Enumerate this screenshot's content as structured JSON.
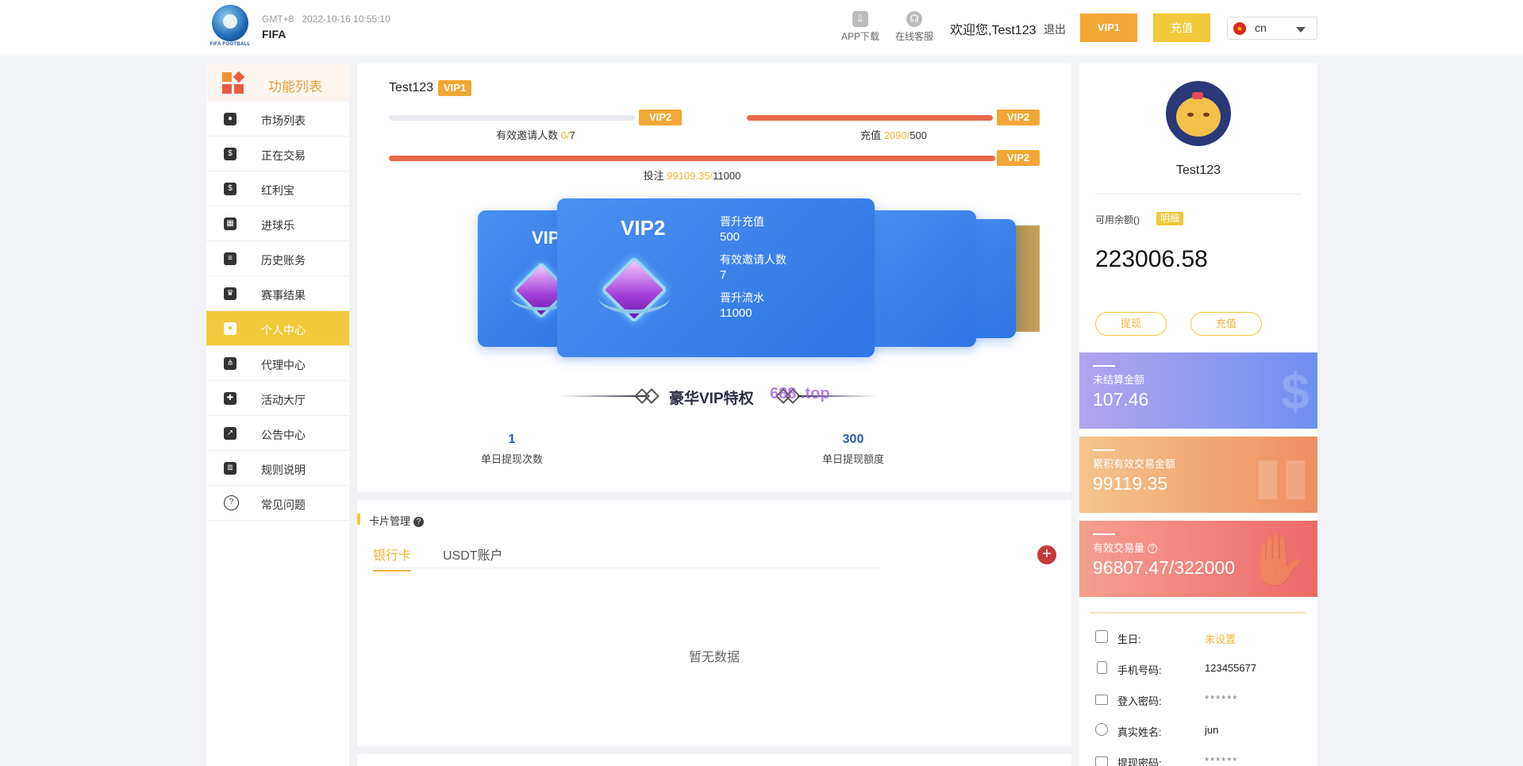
{
  "header": {
    "logo_text": "FIFA FOOTBALL",
    "timezone": "GMT+8",
    "datetime": "2022-10-16 10:55:10",
    "site_name": "FIFA",
    "app_download": "APP下载",
    "online_service": "在线客服",
    "welcome": "欢迎您,Test123",
    "logout": "退出",
    "vip_button": "VIP1",
    "recharge_button": "充值",
    "language": "cn"
  },
  "sidebar": {
    "title": "功能列表",
    "items": [
      {
        "label": "市场列表",
        "icon": "soccer-ball-icon"
      },
      {
        "label": "正在交易",
        "icon": "money-icon"
      },
      {
        "label": "红利宝",
        "icon": "coins-icon"
      },
      {
        "label": "进球乐",
        "icon": "goal-icon"
      },
      {
        "label": "历史账务",
        "icon": "history-icon"
      },
      {
        "label": "赛事结果",
        "icon": "trophy-icon"
      },
      {
        "label": "个人中心",
        "icon": "user-icon",
        "active": true
      },
      {
        "label": "代理中心",
        "icon": "network-icon"
      },
      {
        "label": "活动大厅",
        "icon": "gift-icon"
      },
      {
        "label": "公告中心",
        "icon": "chart-icon"
      },
      {
        "label": "规则说明",
        "icon": "document-icon"
      },
      {
        "label": "常见问题",
        "icon": "question-icon"
      }
    ]
  },
  "vip_progress": {
    "username": "Test123",
    "current_vip": "VIP1",
    "invites": {
      "label": "有效邀请人数",
      "current": "0",
      "target": "7",
      "next": "VIP2",
      "progress": 0
    },
    "recharge": {
      "label": "充值",
      "current": "2090",
      "target": "500",
      "next": "VIP2",
      "progress": 1
    },
    "bet": {
      "label": "投注",
      "current": "99109.35",
      "target": "11000",
      "next": "VIP2",
      "progress": 1
    }
  },
  "vip_card": {
    "title": "VIP2",
    "back_title": "VIP",
    "recharge_label": "晋升充值",
    "recharge_value": "500",
    "invite_label": "有效邀请人数",
    "invite_value": "7",
    "flow_label": "晋升流水",
    "flow_value": "11000",
    "back_text": "t"
  },
  "privileges": {
    "title": "豪华VIP特权",
    "watermark": "688 .top",
    "items": [
      {
        "value": "1",
        "label": "单日提现次数"
      },
      {
        "value": "300",
        "label": "单日提现额度"
      }
    ]
  },
  "card_management": {
    "title": "卡片管理",
    "help": "?",
    "tabs": [
      "银行卡",
      "USDT账户"
    ],
    "active_tab": "银行卡",
    "add": "+",
    "empty_text": "暂无数据"
  },
  "profile": {
    "name": "Test123",
    "available_balance_label": "可用余额()",
    "detail_tag": "明细",
    "balance": "223006.58",
    "withdraw": "提现",
    "recharge": "充值",
    "stats": [
      {
        "label": "未结算金额",
        "value": "107.46",
        "deco": "$"
      },
      {
        "label": "累积有效交易金额",
        "value": "99119.35",
        "deco": "▮▮"
      },
      {
        "label": "有效交易量",
        "value": "96807.47/322000",
        "deco": "✋"
      }
    ],
    "info": [
      {
        "key": "生日:",
        "value": "未设置",
        "highlight": true,
        "icon": "calendar-icon"
      },
      {
        "key": "手机号码:",
        "value": "123455677",
        "icon": "phone-icon"
      },
      {
        "key": "登入密码:",
        "value": "******",
        "icon": "lock-icon"
      },
      {
        "key": "真实姓名:",
        "value": "jun",
        "icon": "person-icon"
      },
      {
        "key": "提现密码:",
        "value": "******",
        "icon": "lock-icon"
      }
    ]
  },
  "colors": {
    "accent": "#f1c93a",
    "vip_orange": "#f2a636",
    "progress_red": "#e86a4b",
    "card_blue": "#3a82ea"
  }
}
